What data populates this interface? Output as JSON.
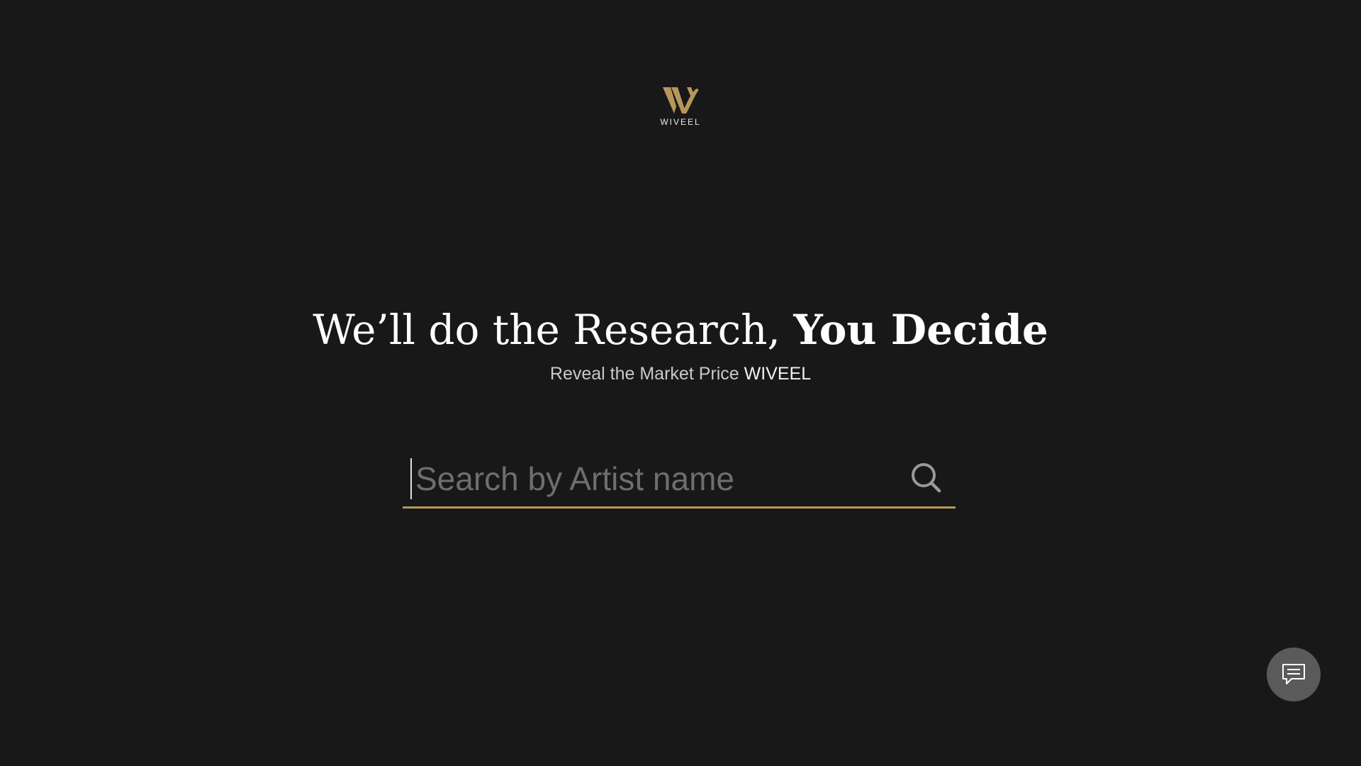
{
  "brand": {
    "name": "WIVEEL",
    "accent_color": "#b8965a",
    "logo_icon": "wiveel-w-logo"
  },
  "hero": {
    "headline_regular": "We’ll do the Research,",
    "headline_bold": "You Decide",
    "subline_prefix": "Reveal the Market Price",
    "subline_brand": "WIVEEL"
  },
  "search": {
    "placeholder": "Search by Artist name",
    "value": "",
    "icon": "search-icon"
  },
  "chat": {
    "icon": "chat-bubble-icon"
  }
}
